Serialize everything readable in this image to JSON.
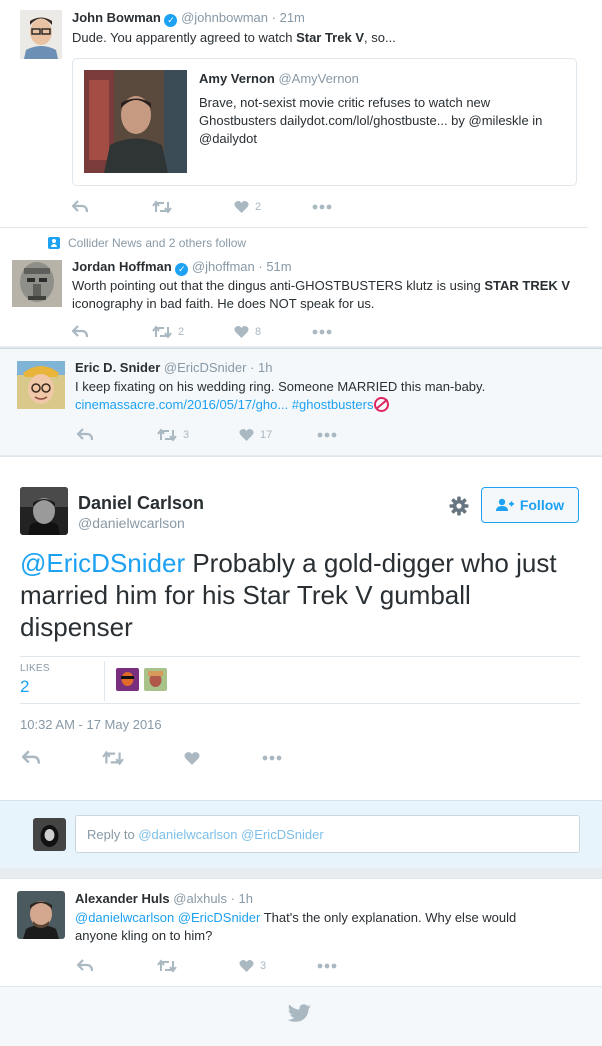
{
  "tweet1": {
    "name": "John Bowman",
    "handle": "@johnbowman",
    "time": "21m",
    "text_pre": "Dude. You apparently agreed to watch ",
    "text_bold": "Star Trek V",
    "text_post": ", so...",
    "quote": {
      "name": "Amy Vernon",
      "handle": "@AmyVernon",
      "text": "Brave, not-sexist movie critic refuses to watch new Ghostbusters dailydot.com/lol/ghostbuste... by @mileskle in @dailydot"
    },
    "likes": "2"
  },
  "tweet2": {
    "context": "Collider News and 2 others follow",
    "name": "Jordan Hoffman",
    "handle": "@jhoffman",
    "time": "51m",
    "text_pre": "Worth pointing out that the dingus anti-GHOSTBUSTERS klutz is using ",
    "text_bold": "STAR TREK V",
    "text_post": " iconography in bad faith. He does NOT speak for us.",
    "retweets": "2",
    "likes": "8"
  },
  "tweet3": {
    "name": "Eric D. Snider",
    "handle": "@EricDSnider",
    "time": "1h",
    "text": "I keep fixating on his wedding ring. Someone MARRIED this man-baby.",
    "link": "cinemassacre.com/2016/05/17/gho...",
    "hashtag": "#ghostbusters",
    "retweets": "3",
    "likes": "17"
  },
  "main": {
    "name": "Daniel Carlson",
    "handle": "@danielwcarlson",
    "follow_label": "Follow",
    "mention": "@EricDSnider",
    "text": " Probably a gold-digger who just married him for his Star Trek V gumball dispenser",
    "likes_label": "LIKES",
    "likes_count": "2",
    "timestamp": "10:32 AM - 17 May 2016"
  },
  "reply_box": {
    "prefix": "Reply to ",
    "mentions": "@danielwcarlson @EricDSnider"
  },
  "tweet4": {
    "name": "Alexander Huls",
    "handle": "@alxhuls",
    "time": "1h",
    "mentions": "@danielwcarlson @EricDSnider",
    "text": " That's the only explanation. Why else would anyone kling on to him?",
    "likes": "3"
  },
  "colors": {
    "accent": "#1da1f2",
    "muted": "#8899a6",
    "icon": "#aab8c2",
    "text": "#292f33",
    "bg": "#e6ecf0"
  }
}
